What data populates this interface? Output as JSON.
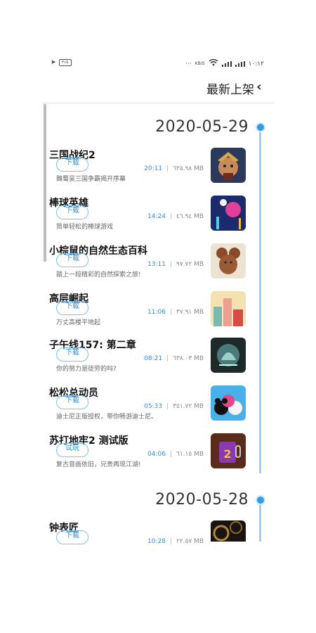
{
  "status": {
    "left_icon": "location-arrow-icon",
    "left_battery": "٣١٥",
    "right_dots": "···",
    "right_speed": "KB/S",
    "right_time": "١٠:١٢"
  },
  "header": {
    "title": "最新上架",
    "back_icon": "‹"
  },
  "sections": [
    {
      "date": "2020-05-29",
      "items": [
        {
          "title": "三国战纪2",
          "button": "下载",
          "desc": "魏蜀吴三国争霸揭开序幕",
          "time": "20:11",
          "size": "٦٣٥.٩٨ MB"
        },
        {
          "title": "棒球英雄",
          "button": "下载",
          "desc": "简单轻松的棒球游戏",
          "time": "14:24",
          "size": "٤٦.٩٤ MB"
        },
        {
          "title": "小棕鼠的自然生态百科",
          "button": "下载",
          "desc": "踏上一段精彩的自然探索之旅!",
          "time": "13:11",
          "size": "٩٧.٧٢ MB"
        },
        {
          "title": "高层崛起",
          "button": "下载",
          "desc": "万丈高楼平地起",
          "time": "11:06",
          "size": "٣٧.٩١ MB"
        },
        {
          "title": "子午线157: 第二章",
          "button": "下载",
          "desc": "你的努力是徒劳的吗?",
          "time": "08:21",
          "size": "٦٣٨.٠٣ MB"
        },
        {
          "title": "松松总动员",
          "button": "下载",
          "desc": "迪士尼正版授权，带你畅游迪士尼。",
          "time": "05:33",
          "size": "٣٥١.٧٢ MB"
        },
        {
          "title": "苏打地牢2 测试版",
          "button": "试玩",
          "desc": "复古音画依旧，兄贵再现江湖!",
          "time": "04:06",
          "size": "٦١.١٥ MB"
        }
      ]
    },
    {
      "date": "2020-05-28",
      "items": [
        {
          "title": "钟表匠",
          "button": "下载",
          "desc": "",
          "time": "10:28",
          "size": "٢٢.٥٧ MB"
        }
      ]
    }
  ]
}
